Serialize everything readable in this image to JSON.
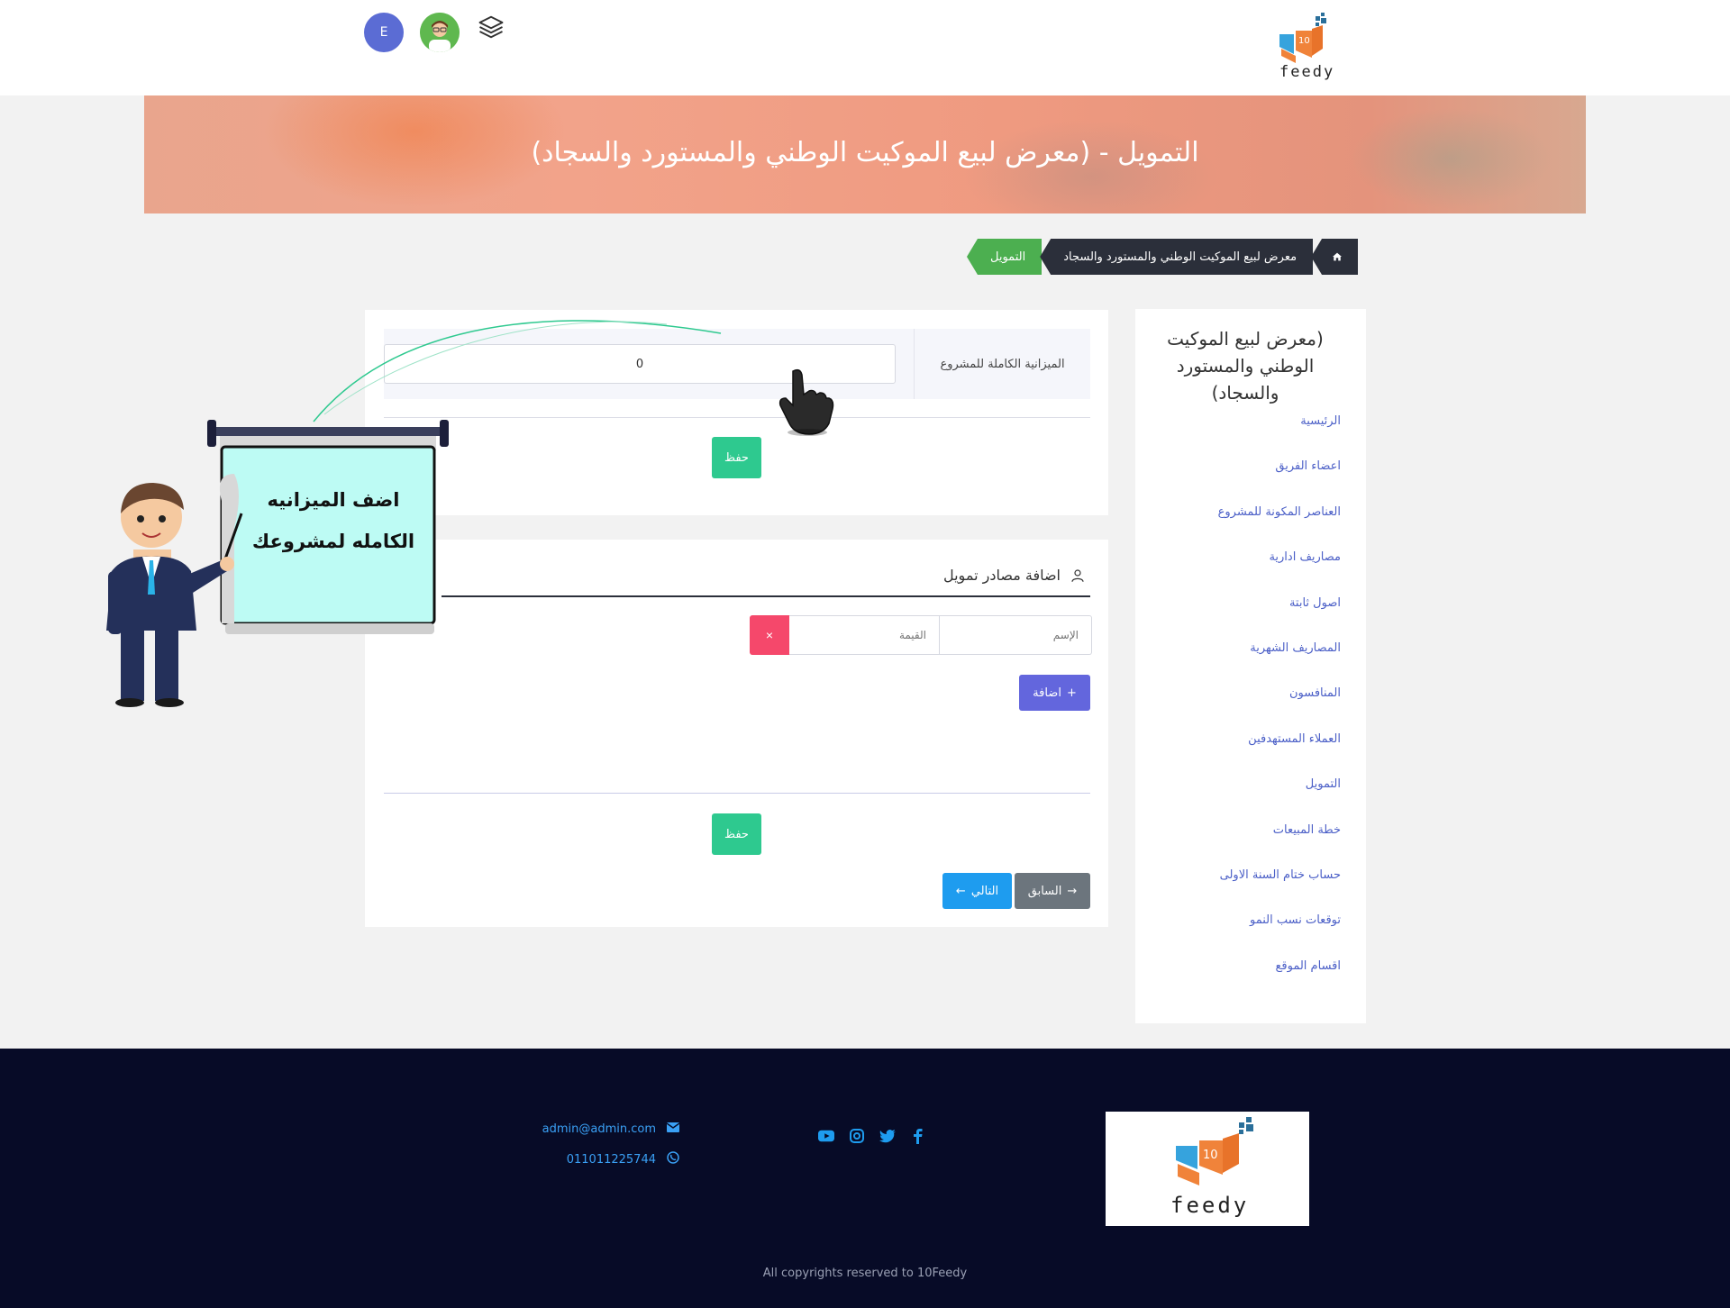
{
  "header": {
    "logo_text": "feedy",
    "avatar_initial": "E"
  },
  "banner": {
    "title": "التمويل - (معرض لبيع الموكيت الوطني والمستورد والسجاد)"
  },
  "breadcrumb": {
    "project": "معرض لبيع الموكيت الوطني والمستورد والسجاد",
    "current": "التمويل"
  },
  "sidebar": {
    "title": "(معرض لبيع الموكيت الوطني والمستورد والسجاد)",
    "items": [
      {
        "label": "الرئيسية"
      },
      {
        "label": "اعضاء الفريق"
      },
      {
        "label": "العناصر المكونة للمشروع"
      },
      {
        "label": "مصاريف ادارية"
      },
      {
        "label": "اصول ثابتة"
      },
      {
        "label": "المصاريف الشهرية"
      },
      {
        "label": "المنافسون"
      },
      {
        "label": "العملاء المستهدفين"
      },
      {
        "label": "التمويل"
      },
      {
        "label": "خطة المبيعات"
      },
      {
        "label": "حساب ختام السنة الاولى"
      },
      {
        "label": "توقعات نسب النمو"
      },
      {
        "label": "اقسام الموقع"
      }
    ]
  },
  "budget": {
    "label": "الميزانية الكاملة للمشروع",
    "value": "0",
    "save_label": "حفظ"
  },
  "sources": {
    "heading": "اضافة مصادر تمويل",
    "name_placeholder": "الإسم",
    "value_placeholder": "القيمة",
    "remove_symbol": "×",
    "add_label": "اضافة",
    "save_label": "حفظ",
    "prev_label": "السابق",
    "next_label": "التالي"
  },
  "tutorial": {
    "line1": "اضف الميزانيه",
    "line2": "الكامله لمشروعك"
  },
  "footer": {
    "logo_text": "feedy",
    "email": "admin@admin.com",
    "phone": "011011225744",
    "copyright": "All copyrights reserved to 10Feedy",
    "social": [
      "youtube-icon",
      "instagram-icon",
      "twitter-icon",
      "facebook-icon"
    ]
  },
  "colors": {
    "primary": "#6366dd",
    "success": "#2ec98f",
    "danger": "#f5486b",
    "info": "#1e9cef",
    "footer": "#070b27",
    "breadcrumb_active": "#4caf50"
  }
}
